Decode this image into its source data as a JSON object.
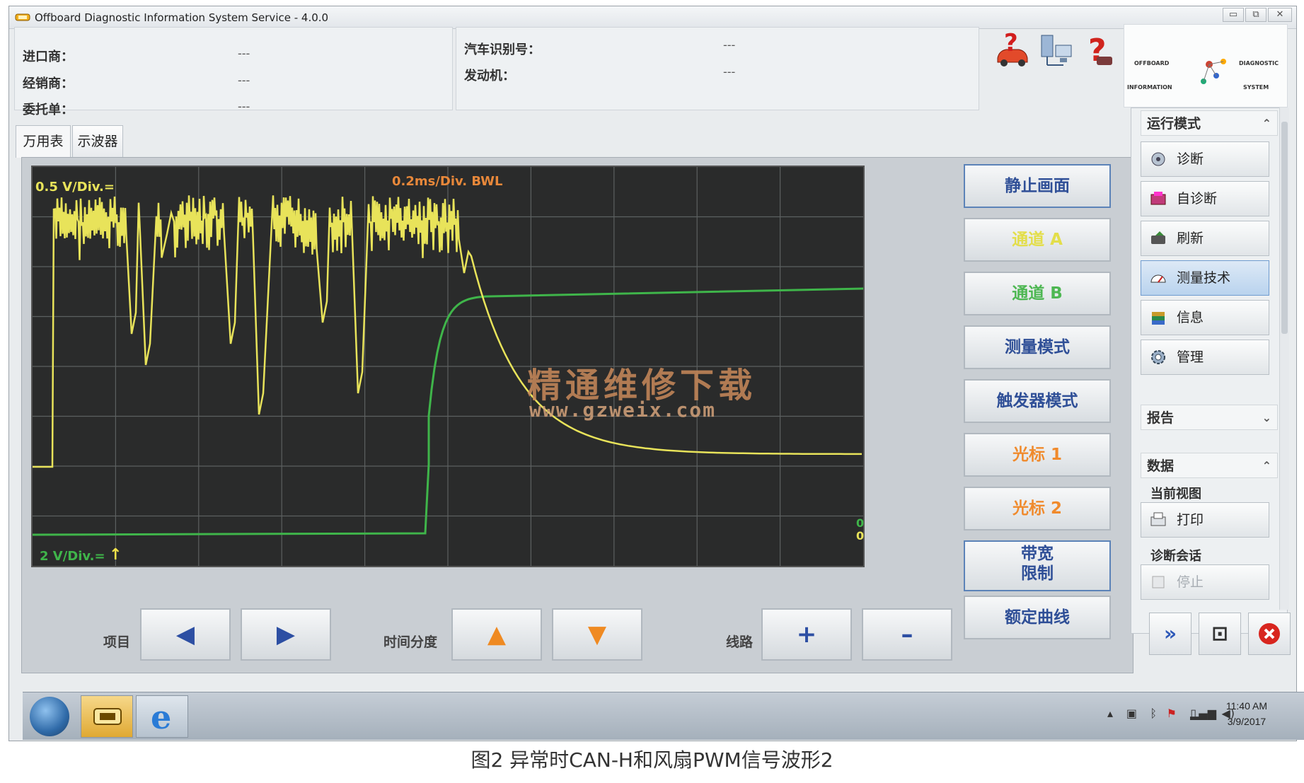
{
  "window": {
    "title": "Offboard Diagnostic Information System Service - 4.0.0",
    "controls": [
      "▭",
      "⧉",
      "✕"
    ]
  },
  "header": {
    "left": [
      {
        "label": "进口商：",
        "value": "---"
      },
      {
        "label": "经销商：",
        "value": "---"
      },
      {
        "label": "委托单：",
        "value": "---"
      }
    ],
    "right": [
      {
        "label": "汽车识别号：",
        "value": "---"
      },
      {
        "label": "发动机：",
        "value": "---"
      }
    ],
    "brand_lines": [
      "OFFBOARD",
      "DIAGNOSTIC",
      "INFORMATION",
      "SYSTEM"
    ]
  },
  "tabs": [
    {
      "label": "万用表",
      "active": true
    },
    {
      "label": "示波器",
      "active": false
    }
  ],
  "scope": {
    "channel_a_scale": "0.5 V/Div.=",
    "time_scale": "0.2ms/Div. BWL",
    "channel_b_scale": "2 V/Div.=",
    "zero_marker_a": "0",
    "zero_marker_b": "0",
    "channel_a_color": "#e8e35a",
    "channel_b_color": "#3fb54a"
  },
  "watermark": {
    "text": "精通维修下载",
    "url": "www.gzweix.com"
  },
  "scope_buttons": [
    {
      "label": "静止画面",
      "color": "#2f4f97",
      "boxed": true
    },
    {
      "label": "通道 A",
      "color": "#e3de4a",
      "boxed": false
    },
    {
      "label": "通道 B",
      "color": "#4db752",
      "boxed": false
    },
    {
      "label": "测量模式",
      "color": "#2f4f97",
      "boxed": false
    },
    {
      "label": "触发器模式",
      "color": "#2f4f97",
      "boxed": false
    },
    {
      "label": "光标 1",
      "color": "#f08a2c",
      "boxed": false
    },
    {
      "label": "光标 2",
      "color": "#f08a2c",
      "boxed": false
    },
    {
      "label": "带宽\n限制",
      "color": "#2f4f97",
      "boxed": true
    },
    {
      "label": "额定曲线",
      "color": "#2f4f97",
      "boxed": false
    }
  ],
  "bottom_controls": {
    "item_label": "项目",
    "time_label": "时间分度",
    "line_label": "线路",
    "prev": "◀",
    "next": "▶",
    "up": "▲",
    "down": "▼",
    "plus": "+",
    "minus": "–"
  },
  "sidebar": {
    "mode_header": "运行模式",
    "items": [
      {
        "label": "诊断",
        "icon": "diagnosis-icon",
        "active": false
      },
      {
        "label": "自诊断",
        "icon": "self-diagnosis-icon",
        "active": false
      },
      {
        "label": "刷新",
        "icon": "flash-icon",
        "active": false
      },
      {
        "label": "测量技术",
        "icon": "gauge-icon",
        "active": true
      },
      {
        "label": "信息",
        "icon": "books-icon",
        "active": false
      },
      {
        "label": "管理",
        "icon": "gear-icon",
        "active": false
      }
    ],
    "report_header": "报告",
    "data_header": "数据",
    "current_view": "当前视图",
    "print": "打印",
    "session": "诊断会话",
    "stop": "停止"
  },
  "taskbar": {
    "time": "11:40 AM",
    "date": "3/9/2017"
  },
  "caption": "图2 异常时CAN-H和风扇PWM信号波形2"
}
